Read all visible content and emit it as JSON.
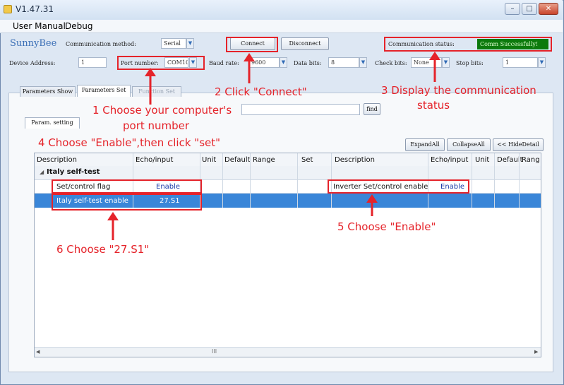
{
  "window": {
    "title": "V1.47.31",
    "min": "–",
    "max": "□",
    "close": "✕"
  },
  "menu": [
    "User Manual",
    "Debug"
  ],
  "brand": "SunnyBee",
  "comm": {
    "method_label": "Communication method:",
    "method_value": "Serial",
    "connect": "Connect",
    "disconnect": "Disconnect",
    "status_label": "Communication status:",
    "status_value": "Comm Successfully!"
  },
  "serial": {
    "device_address_label": "Device Address:",
    "device_address": "1",
    "port_label": "Port number:",
    "port_value": "COM10",
    "baud_label": "Baud rate:",
    "baud_value": "9600",
    "data_bits_label": "Data bits:",
    "data_bits_value": "8",
    "check_bits_label": "Check bits:",
    "check_bits_value": "None",
    "stop_bits_label": "Stop bits:",
    "stop_bits_value": "1"
  },
  "tabs": [
    "Parameters Show",
    "Parameters Set",
    "Function Set"
  ],
  "subtab": "Param. setting",
  "find_button": "find",
  "grid_buttons": {
    "expand": "ExpandAll",
    "collapse": "CollapseAll",
    "hide": "<< HideDetail"
  },
  "columns": {
    "left": [
      "Description",
      "Echo/input",
      "Unit",
      "Default",
      "Range",
      "Set"
    ],
    "right": [
      "Description",
      "Echo/input",
      "Unit",
      "Default",
      "Rang"
    ]
  },
  "group": {
    "toggle": "◢",
    "label": "Italy self-test"
  },
  "rows": [
    {
      "desc": "Set/control flag",
      "echo": "Enable",
      "right_desc": "Inverter Set/control enable",
      "right_echo": "Enable"
    },
    {
      "desc": "Italy self-test enable",
      "echo": "27.S1"
    }
  ],
  "scroll_marker": "III",
  "annotations": {
    "a1_line1": "1 Choose your computer's",
    "a1_line2": "port number",
    "a2": "2 Click \"Connect\"",
    "a3_line1": "3 Display the communication",
    "a3_line2": "status",
    "a4": "4 Choose \"Enable\",then click \"set\"",
    "a5": "5 Choose \"Enable\"",
    "a6": "6 Choose \"27.S1\""
  },
  "colors": {
    "annotation": "#e5232a",
    "status_ok": "#0c7a0c",
    "selected_row": "#3a86d8"
  }
}
